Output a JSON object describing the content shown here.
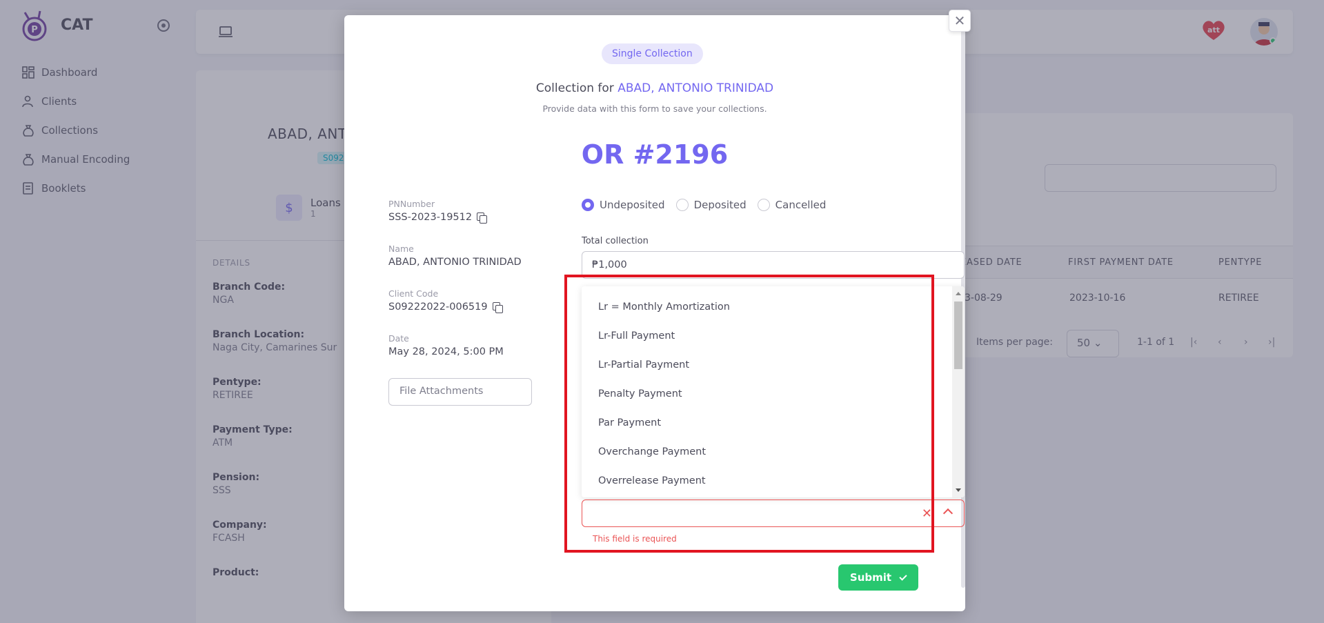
{
  "app": {
    "name": "CAT"
  },
  "sidebar": {
    "items": [
      {
        "label": "Dashboard",
        "icon": "dashboard-icon"
      },
      {
        "label": "Clients",
        "icon": "user-icon"
      },
      {
        "label": "Collections",
        "icon": "bag-icon"
      },
      {
        "label": "Manual Encoding",
        "icon": "bag-icon"
      },
      {
        "label": "Booklets",
        "icon": "book-icon"
      }
    ]
  },
  "profile": {
    "name": "ABAD, ANT",
    "badge": "S092",
    "loans_label": "Loans",
    "loans_count": "1",
    "details_title": "DETAILS",
    "details": [
      {
        "k": "Branch Code:",
        "v": "NGA"
      },
      {
        "k": "Branch Location:",
        "v": "Naga City, Camarines Sur"
      },
      {
        "k": "Pentype:",
        "v": "RETIREE"
      },
      {
        "k": "Payment Type:",
        "v": "ATM"
      },
      {
        "k": "Pension:",
        "v": "SSS"
      },
      {
        "k": "Company:",
        "v": "FCASH"
      },
      {
        "k": "Product:",
        "v": ""
      }
    ]
  },
  "table": {
    "headers": [
      "EASED DATE",
      "FIRST PAYMENT DATE",
      "PENTYPE"
    ],
    "row": [
      "3-08-29",
      "2023-10-16",
      "RETIREE"
    ],
    "items_per_page_label": "Items per page:",
    "items_per_page": "50",
    "range": "1-1 of 1"
  },
  "modal": {
    "pill": "Single Collection",
    "title_prefix": "Collection for ",
    "title_name": "ABAD, ANTONIO TRINIDAD",
    "subtitle": "Provide data with this form to save your collections.",
    "or_number": "OR #2196",
    "info": [
      {
        "k": "PNNumber",
        "v": "SSS-2023-19512",
        "copy": true
      },
      {
        "k": "Name",
        "v": "ABAD, ANTONIO TRINIDAD",
        "copy": false
      },
      {
        "k": "Client Code",
        "v": "S09222022-006519",
        "copy": true
      },
      {
        "k": "Date",
        "v": "May 28, 2024, 5:00 PM",
        "copy": false
      }
    ],
    "file_attachments": "File Attachments",
    "status_options": [
      "Undeposited",
      "Deposited",
      "Cancelled"
    ],
    "status_selected": "Undeposited",
    "total_collection_label": "Total collection",
    "total_collection_value": "₱1,000",
    "dropdown_options": [
      "Lr = Monthly Amortization",
      "Lr-Full Payment",
      "Lr-Partial Payment",
      "Penalty Payment",
      "Par Payment",
      "Overchange Payment",
      "Overrelease Payment"
    ],
    "select_value": "",
    "error": "This field is required",
    "submit": "Submit"
  },
  "colors": {
    "accent": "#7367f0",
    "success": "#28c76f",
    "danger": "#ea5455",
    "highlight": "#e11521"
  }
}
